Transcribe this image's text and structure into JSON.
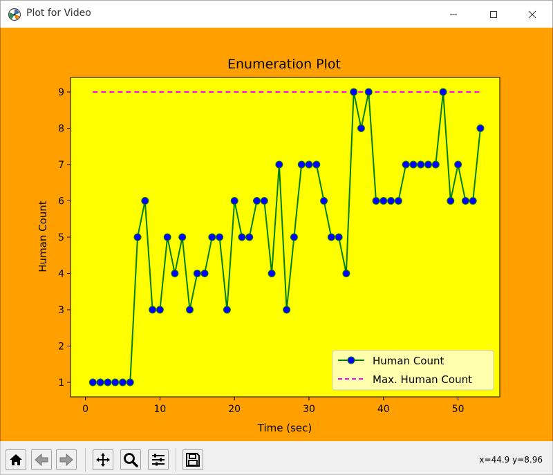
{
  "window": {
    "title": "Plot for Video"
  },
  "toolbar": {
    "coords_readout": "x=44.9 y=8.96",
    "buttons": [
      "home-icon",
      "back-icon",
      "forward-icon",
      "pan-icon",
      "zoom-icon",
      "configure-subplots-icon",
      "save-icon"
    ]
  },
  "colors": {
    "figure_bg": "#ffa000",
    "axes_bg": "#ffff00",
    "line": "#008000",
    "marker": "#0000ff",
    "max_line": "#ff00ff"
  },
  "chart_data": {
    "type": "line",
    "title": "Enumeration Plot",
    "xlabel": "Time (sec)",
    "ylabel": "Human Count",
    "xlim": [
      -2,
      55.6
    ],
    "ylim": [
      0.6,
      9.4
    ],
    "xticks": [
      0,
      10,
      20,
      30,
      40,
      50
    ],
    "yticks": [
      1,
      2,
      3,
      4,
      5,
      6,
      7,
      8,
      9
    ],
    "grid": false,
    "legend_position": "lower-right",
    "series": [
      {
        "name": "Human Count",
        "style": "solid-with-markers",
        "x": [
          1,
          2,
          3,
          4,
          5,
          6,
          7,
          8,
          9,
          10,
          11,
          12,
          13,
          14,
          15,
          16,
          17,
          18,
          19,
          20,
          21,
          22,
          23,
          24,
          25,
          26,
          27,
          28,
          29,
          30,
          31,
          32,
          33,
          34,
          35,
          36,
          37,
          38,
          39,
          40,
          41,
          42,
          43,
          44,
          45,
          46,
          47,
          48,
          49,
          50,
          51,
          52,
          53
        ],
        "values": [
          1,
          1,
          1,
          1,
          1,
          1,
          5,
          6,
          3,
          3,
          5,
          4,
          5,
          3,
          4,
          4,
          5,
          5,
          3,
          6,
          5,
          5,
          6,
          6,
          4,
          7,
          3,
          5,
          7,
          7,
          7,
          6,
          5,
          5,
          4,
          9,
          8,
          9,
          6,
          6,
          6,
          6,
          7,
          7,
          7,
          7,
          7,
          9,
          6,
          7,
          6,
          6,
          8
        ]
      },
      {
        "name": "Max. Human Count",
        "style": "dashed",
        "x": [
          1,
          53
        ],
        "values": [
          9,
          9
        ]
      }
    ]
  }
}
